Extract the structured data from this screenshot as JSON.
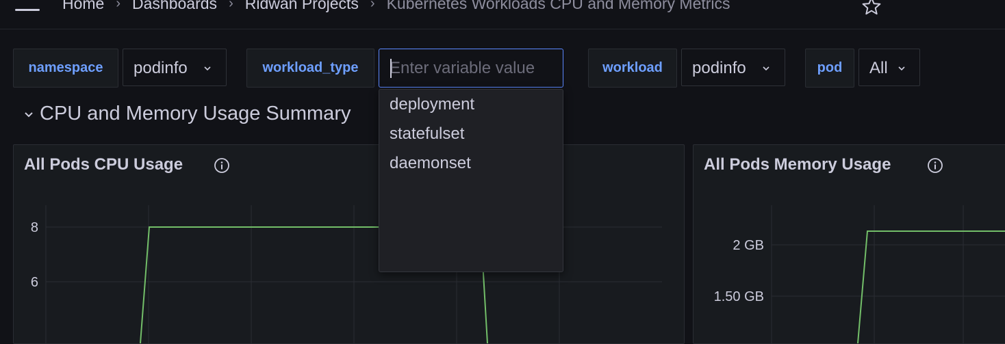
{
  "breadcrumb": {
    "items": [
      "Home",
      "Dashboards",
      "Ridwan Projects",
      "Kubernetes Workloads CPU and Memory Metrics"
    ]
  },
  "variables": {
    "namespace": {
      "label": "namespace",
      "value": "podinfo"
    },
    "workload_type": {
      "label": "workload_type",
      "placeholder": "Enter variable value",
      "options": [
        "deployment",
        "statefulset",
        "daemonset"
      ]
    },
    "workload": {
      "label": "workload",
      "value": "podinfo"
    },
    "pod": {
      "label": "pod",
      "value": "All"
    }
  },
  "section": {
    "title": "CPU and Memory Usage Summary"
  },
  "panels": {
    "cpu": {
      "title": "All Pods CPU Usage",
      "yticks": [
        "8",
        "6"
      ]
    },
    "memory": {
      "title": "All Pods Memory Usage",
      "yticks": [
        "2 GB",
        "1.50 GB"
      ]
    }
  },
  "colors": {
    "accent": "#6e9fff",
    "series": "#73bf69",
    "background": "#111217",
    "panel": "#181b1f"
  }
}
